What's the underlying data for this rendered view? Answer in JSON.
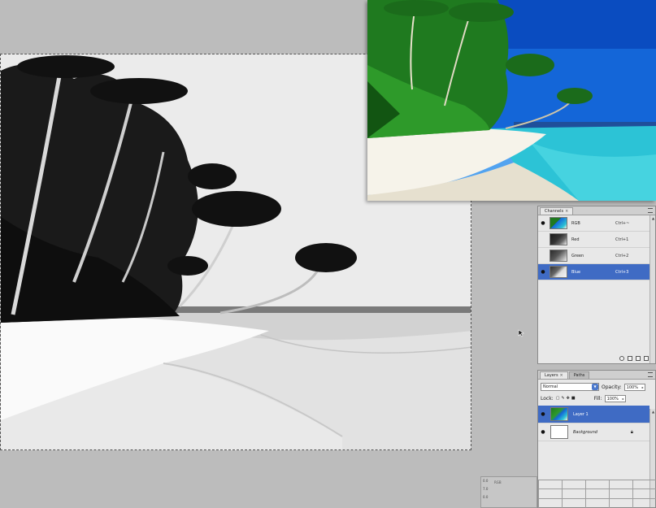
{
  "channels_panel": {
    "tab_label": "Channels",
    "close_glyph": "×",
    "rows": [
      {
        "name": "RGB",
        "shortcut": "Ctrl+~",
        "visible": true,
        "selected": false,
        "thumb": "color"
      },
      {
        "name": "Red",
        "shortcut": "Ctrl+1",
        "visible": false,
        "selected": false,
        "thumb": "dark"
      },
      {
        "name": "Green",
        "shortcut": "Ctrl+2",
        "visible": false,
        "selected": false,
        "thumb": "gray"
      },
      {
        "name": "Blue",
        "shortcut": "Ctrl+3",
        "visible": true,
        "selected": true,
        "thumb": "light"
      }
    ]
  },
  "layers_panel": {
    "tabs": [
      {
        "label": "Layers",
        "active": true
      },
      {
        "label": "Paths",
        "active": false
      }
    ],
    "blend_mode": "Normal",
    "opacity_label": "Opacity:",
    "opacity_value": "100%",
    "lock_label": "Lock:",
    "fill_label": "Fill:",
    "fill_value": "100%",
    "layers": [
      {
        "name": "Layer 1",
        "selected": true,
        "italic": false
      },
      {
        "name": "Background",
        "selected": false,
        "italic": true
      }
    ]
  },
  "mini_info": {
    "lines": [
      "0.0",
      "7.0",
      "0.0"
    ],
    "label": "RGB"
  },
  "icons": {
    "eye": "eye-icon",
    "lock": "lock-icon",
    "cursor": "arrow-cursor-icon"
  },
  "colors": {
    "selection_blue": "#3f6bc4",
    "workspace_gray": "#bcbcbc",
    "panel_bg": "#e8e8e8",
    "sky_blue": "#1466d8",
    "sea_turquoise": "#2cc3d6"
  }
}
